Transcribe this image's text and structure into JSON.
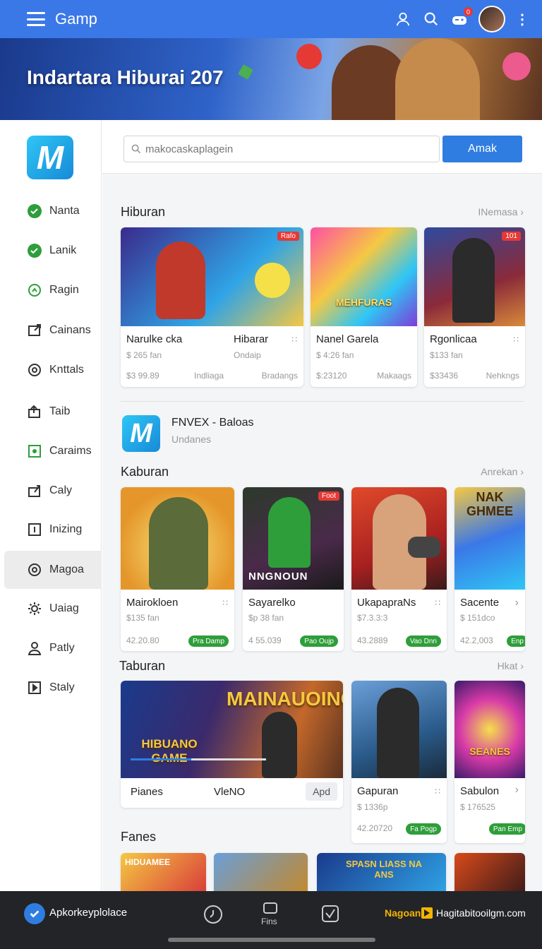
{
  "topbar": {
    "brand": "Gamp",
    "notification_count": "0"
  },
  "hero": {
    "title": "Indartara Hiburai 207"
  },
  "sidebar": {
    "items": [
      {
        "label": "Nanta",
        "icon": "check-circle-icon"
      },
      {
        "label": "Lanik",
        "icon": "check-circle-icon"
      },
      {
        "label": "Ragin",
        "icon": "refresh-icon"
      },
      {
        "label": "Cainans",
        "icon": "external-link-icon"
      },
      {
        "label": "Knttals",
        "icon": "target-icon"
      },
      {
        "label": "Taib",
        "icon": "share-icon"
      },
      {
        "label": "Caraims",
        "icon": "square-dot-icon"
      },
      {
        "label": "Caly",
        "icon": "export-icon"
      },
      {
        "label": "Inizing",
        "icon": "info-box-icon"
      },
      {
        "label": "Magoa",
        "icon": "at-icon"
      },
      {
        "label": "Uaiag",
        "icon": "settings-icon"
      },
      {
        "label": "Patly",
        "icon": "user-icon"
      },
      {
        "label": "Staly",
        "icon": "play-box-icon"
      }
    ]
  },
  "search": {
    "placeholder": "makocaskaplagein",
    "button": "Amak"
  },
  "sections": {
    "s1": {
      "title": "Hiburan",
      "link": "INemasa"
    },
    "app": {
      "name": "FNVEX - Baloas",
      "sub": "Undanes"
    },
    "s2": {
      "title": "Kaburan",
      "link": "Anrekan"
    },
    "s3": {
      "title": "Taburan",
      "link": "Hkat"
    },
    "s4": {
      "title": "Fanes"
    }
  },
  "row1": [
    {
      "title": "Narulke cka",
      "title2": "Hibarar",
      "sub2": "Ondaip",
      "meta": "$ 265 fan",
      "price": "$3 99.89",
      "mid": "Indliaga",
      "right": "Bradangs",
      "tag": "Rafo"
    },
    {
      "title": "Nanel Garela",
      "meta": "$ 4:26 fan",
      "price": "$:23120",
      "right": "Makaags",
      "img_text": "MEHFURAS"
    },
    {
      "title": "Rgonlicaa",
      "meta": "$133 fan",
      "price": "$33436",
      "right": "Nehkngs",
      "tag": "101"
    }
  ],
  "row2": [
    {
      "title": "Mairokloen",
      "meta": "$135 fan",
      "price": "42.20.80",
      "pill": "Pra Damp"
    },
    {
      "title": "Sayarelko",
      "meta": "$p 38 fan",
      "price": "4 55.039",
      "pill": "Pao Oujp",
      "img_text": "NNGNOUN",
      "tag": "Foot"
    },
    {
      "title": "UkapapraNs",
      "meta": "$7.3.3:3",
      "price": "43.2889",
      "pill": "Vao Dnn"
    },
    {
      "title": "Sacente",
      "meta": "$ 151dco",
      "price": "42.2,003",
      "pill": "Enp",
      "img_text": "NAK GHMEE"
    }
  ],
  "row3": {
    "wide": {
      "img_text": "MAINAUOING",
      "img_sub": "HIBUANO GAME",
      "left": "Pianes",
      "right": "VleNO",
      "button": "Apd",
      "progress": 0.45
    },
    "cards": [
      {
        "title": "Gapuran",
        "meta": "$ 1336p",
        "price": "42.20720",
        "pill": "Fa Pogp"
      },
      {
        "title": "Sabulon",
        "meta": "$ 176525",
        "pill": "Pan Emp",
        "img_text": "SEANES"
      }
    ]
  },
  "row4": [
    {
      "img_text": "HIDUAMEE"
    },
    {
      "img_text": ""
    },
    {
      "img_text": "SPASN LIASS NA ANS"
    },
    {
      "img_text": ""
    }
  ],
  "bottombar": {
    "left": "Apkorkeyplolace",
    "mid": "Fins",
    "ad": "Nagoan",
    "right": "Hagitabitooilgm.com"
  }
}
